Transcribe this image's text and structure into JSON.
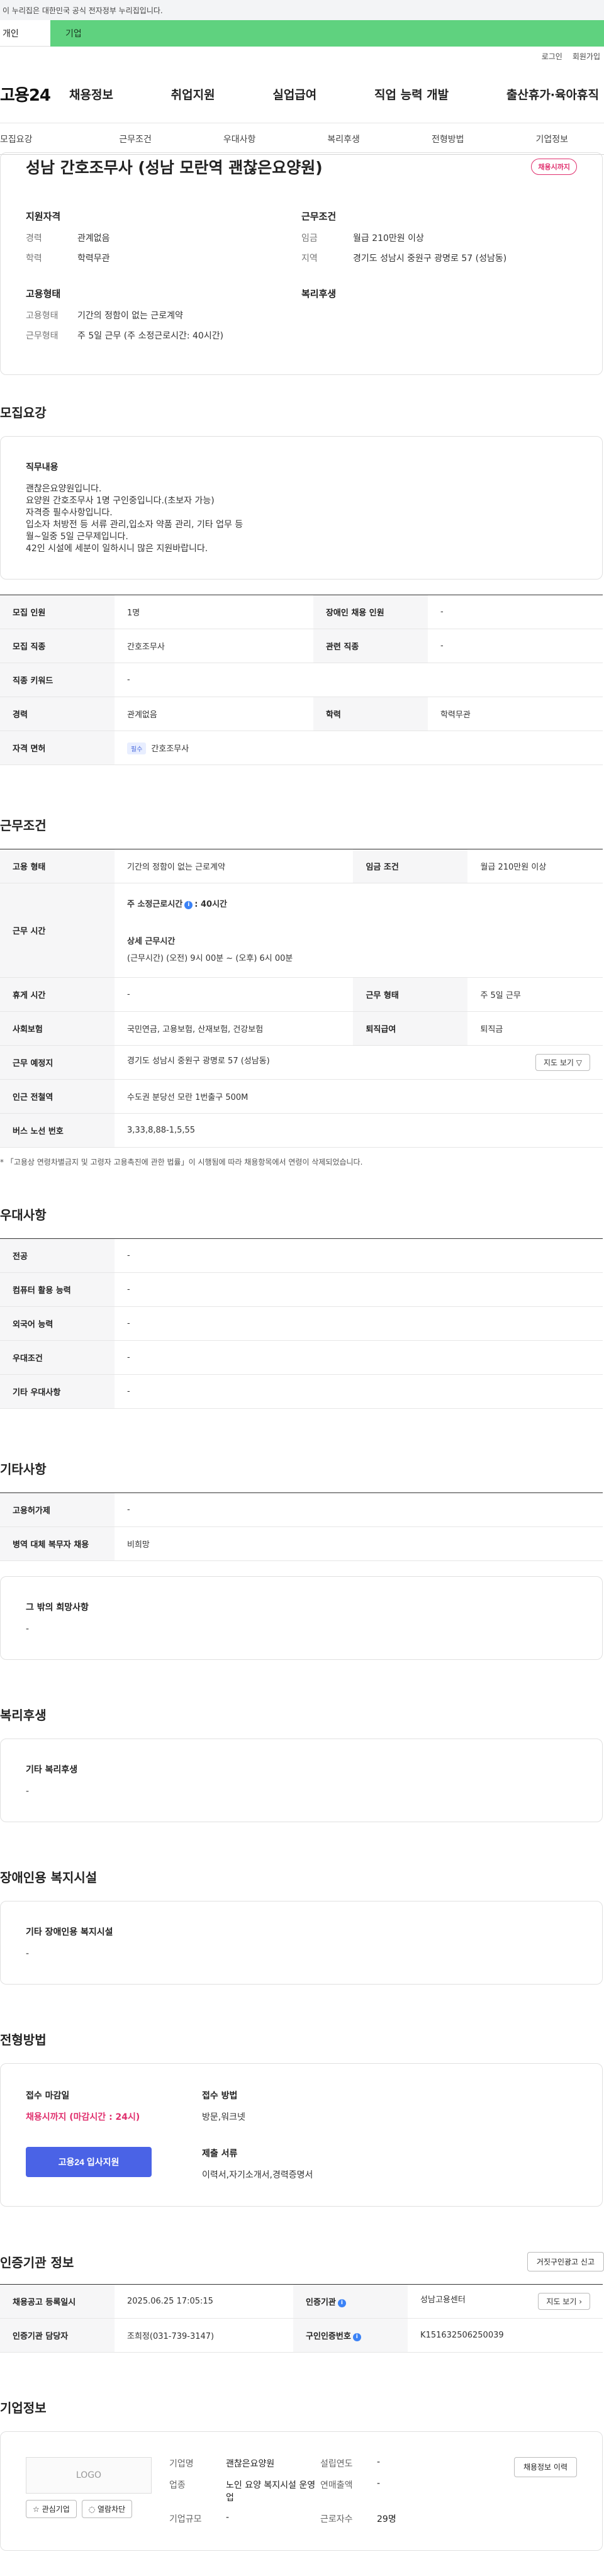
{
  "banner": "이 누리집은 대한민국 공식 전자정부 누리집입니다.",
  "user_switch": {
    "personal": "개인",
    "corporate": "기업"
  },
  "util_links": [
    "로그인",
    "회원가입"
  ],
  "gnb": {
    "logo": "고용24",
    "menus": [
      "채용정보",
      "취업지원",
      "실업급여",
      "직업 능력 개발",
      "출산휴가·육아휴직"
    ]
  },
  "tabs": [
    "모집요강",
    "근무조건",
    "우대사항",
    "복리후생",
    "전형방법",
    "기업정보"
  ],
  "summary": {
    "title": "성남 간호조무사 (성남 모란역 괜찮은요양원)",
    "badge": "채용시까지",
    "qual_title": "지원자격",
    "career_k": "경력",
    "career_v": "관계없음",
    "edu_k": "학력",
    "edu_v": "학력무관",
    "cond_title": "근무조건",
    "wage_k": "임금",
    "wage_v": "월급 210만원 이상",
    "region_k": "지역",
    "region_v": "경기도 성남시 중원구 광명로 57 (성남동)",
    "emp_title": "고용형태",
    "emptype_k": "고용형태",
    "emptype_v": "기간의 정함이 없는 근로계약",
    "worktype_k": "근무형태",
    "worktype_v": "주 5일 근무 (주 소정근로시간: 40시간)",
    "welfare_title": "복리후생"
  },
  "recruit": {
    "section": "모집요강",
    "duty_title": "직무내용",
    "duty_text": "괜찮은요양원입니다.\n요양원 간호조무사 1명 구인중입니다.(초보자 가능)\n자격증 필수사항입니다.\n입소자 처방전 등 서류 관리,입소자 약품 관리, 기타 업무 등\n월~일중 5일 근무제입니다.\n42인 시설에 세분이 일하시니 많은 지원바랍니다.",
    "rows": {
      "headcount_k": "모집 인원",
      "headcount_v": "1명",
      "disabled_k": "장애인 채용 인원",
      "disabled_v": "-",
      "job_k": "모집 직종",
      "job_v": "간호조무사",
      "related_k": "관련 직종",
      "related_v": "-",
      "keyword_k": "직종 키워드",
      "keyword_v": "-",
      "career_k": "경력",
      "career_v": "관계없음",
      "edu_k": "학력",
      "edu_v": "학력무관",
      "license_k": "자격 면허",
      "license_tag": "필수",
      "license_v": "간호조무사"
    }
  },
  "work": {
    "section": "근무조건",
    "emptype_k": "고용 형태",
    "emptype_v": "기간의 정함이 없는 근로계약",
    "wage_k": "임금 조건",
    "wage_v": "월급 210만원 이상",
    "hours_k": "근무 시간",
    "hours_main": "주 소정근로시간",
    "hours_main_v": ": 40시간",
    "hours_detail_title": "상세 근무시간",
    "hours_detail": "(근무시간) (오전) 9시 00분 ~ (오후) 6시 00분",
    "rest_k": "휴게 시간",
    "rest_v": "-",
    "worktype_k": "근무 형태",
    "worktype_v": "주 5일 근무",
    "insurance_k": "사회보험",
    "insurance_v": "국민연금, 고용보험, 산재보험, 건강보험",
    "severance_k": "퇴직급여",
    "severance_v": "퇴직금",
    "place_k": "근무 예정지",
    "place_v": "경기도 성남시 중원구 광명로 57 (성남동)",
    "map_btn": "지도 보기 ▽",
    "station_k": "인근 전철역",
    "station_v": "수도권 분당선 모란 1번출구 500M",
    "bus_k": "버스 노선 번호",
    "bus_v": "3,33,8,88-1,5,55",
    "note": "* 「고용상 연령차별금지 및 고령자 고용촉진에 관한 법률」이 시행됨에 따라 채용항목에서 연령이 삭제되었습니다."
  },
  "pref": {
    "section": "우대사항",
    "major_k": "전공",
    "major_v": "-",
    "computer_k": "컴퓨터 활용 능력",
    "computer_v": "-",
    "lang_k": "외국어 능력",
    "lang_v": "-",
    "cond_k": "우대조건",
    "cond_v": "-",
    "etc_k": "기타 우대사항",
    "etc_v": "-"
  },
  "other": {
    "section": "기타사항",
    "perm_k": "고용허가제",
    "perm_v": "-",
    "mil_k": "병역 대체 복무자 채용",
    "mil_v": "비희망",
    "hope_title": "그 밖의 희망사항",
    "hope_v": "-"
  },
  "welfare": {
    "section": "복리후생",
    "title": "기타 복리후생",
    "v": "-"
  },
  "disabled": {
    "section": "장애인용 복지시설",
    "title": "기타 장애인용 복지시설",
    "v": "-"
  },
  "apply": {
    "section": "전형방법",
    "deadline_title": "접수 마감일",
    "deadline_v": "채용시까지 (마감시간 : 24시)",
    "btn": "고용24 입사지원",
    "method_title": "접수 방법",
    "method_v": "방문,워크넷",
    "docs_title": "제출 서류",
    "docs_v": "이력서,자기소개서,경력증명서"
  },
  "cert": {
    "section": "인증기관 정보",
    "report_btn": "거짓구인광고 신고",
    "reg_k": "채용공고 등록일시",
    "reg_v": "2025.06.25 17:05:15",
    "org_k": "인증기관",
    "org_v": "성남고용센터",
    "map_btn": "지도 보기 ›",
    "mgr_k": "인증기관 담당자",
    "mgr_v": "조희정(031-739-3147)",
    "no_k": "구인인증번호",
    "no_v": "K151632506250039"
  },
  "company": {
    "section": "기업정보",
    "logo": "LOGO",
    "btn_fav": "☆ 관심기업",
    "btn_block": "◌ 열람차단",
    "name_k": "기업명",
    "name_v": "괜찮은요양원",
    "year_k": "설립연도",
    "year_v": "-",
    "industry_k": "업종",
    "industry_v": "노인 요양 복지시설 운영업",
    "sales_k": "연매출액",
    "sales_v": "-",
    "size_k": "기업규모",
    "size_v": "-",
    "staff_k": "근로자수",
    "staff_v": "29명",
    "hist_btn": "채용정보 이력"
  }
}
